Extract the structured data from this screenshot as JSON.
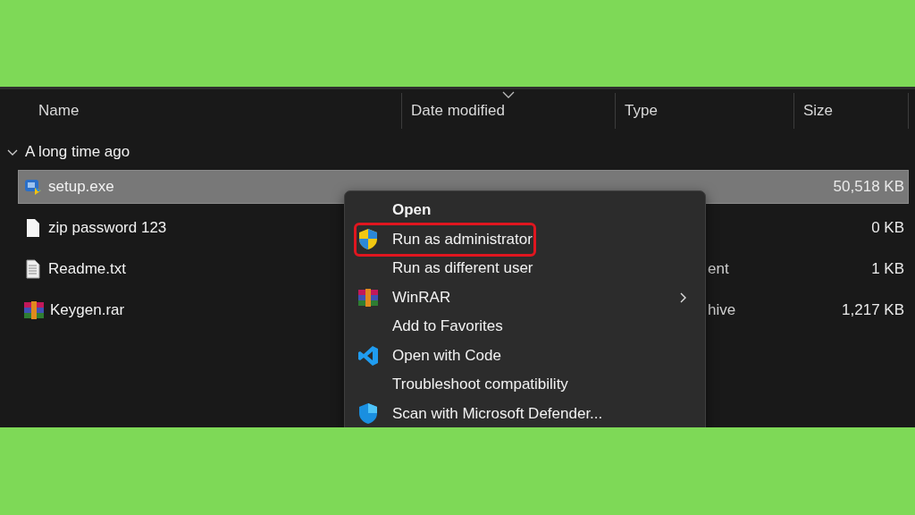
{
  "columns": [
    {
      "label": "Name",
      "sorted": false
    },
    {
      "label": "Date modified",
      "sorted": true
    },
    {
      "label": "Type",
      "sorted": false
    },
    {
      "label": "Size",
      "sorted": false
    }
  ],
  "group": {
    "label": "A long time ago",
    "expanded": true
  },
  "files": [
    {
      "name": "setup.exe",
      "kind": "installer",
      "size": "50,518 KB",
      "selected": true
    },
    {
      "name": "zip password 123",
      "kind": "blank",
      "size": "0 KB",
      "selected": false
    },
    {
      "name": "Readme.txt",
      "kind": "text",
      "type": "ent",
      "type_cut": true,
      "size": "1 KB",
      "selected": false
    },
    {
      "name": "Keygen.rar",
      "kind": "archive",
      "type": "hive",
      "type_cut": true,
      "size": "1,217 KB",
      "selected": false
    }
  ],
  "menu": {
    "items": [
      {
        "label": "Open",
        "kind": "plain",
        "default": true,
        "highlighted": false,
        "submenu": false
      },
      {
        "label": "Run as administrator",
        "kind": "shield",
        "default": false,
        "highlighted": true,
        "submenu": false
      },
      {
        "label": "Run as different user",
        "kind": "plain",
        "default": false,
        "highlighted": false,
        "submenu": false
      },
      {
        "label": "WinRAR",
        "kind": "archive",
        "default": false,
        "highlighted": false,
        "submenu": true
      },
      {
        "label": "Add to Favorites",
        "kind": "plain",
        "default": false,
        "highlighted": false,
        "submenu": false
      },
      {
        "label": "Open with Code",
        "kind": "code",
        "default": false,
        "highlighted": false,
        "submenu": false
      },
      {
        "label": "Troubleshoot compatibility",
        "kind": "plain",
        "default": false,
        "highlighted": false,
        "submenu": false
      },
      {
        "label": "Scan with Microsoft Defender...",
        "kind": "defender",
        "default": false,
        "highlighted": false,
        "submenu": false
      }
    ]
  }
}
